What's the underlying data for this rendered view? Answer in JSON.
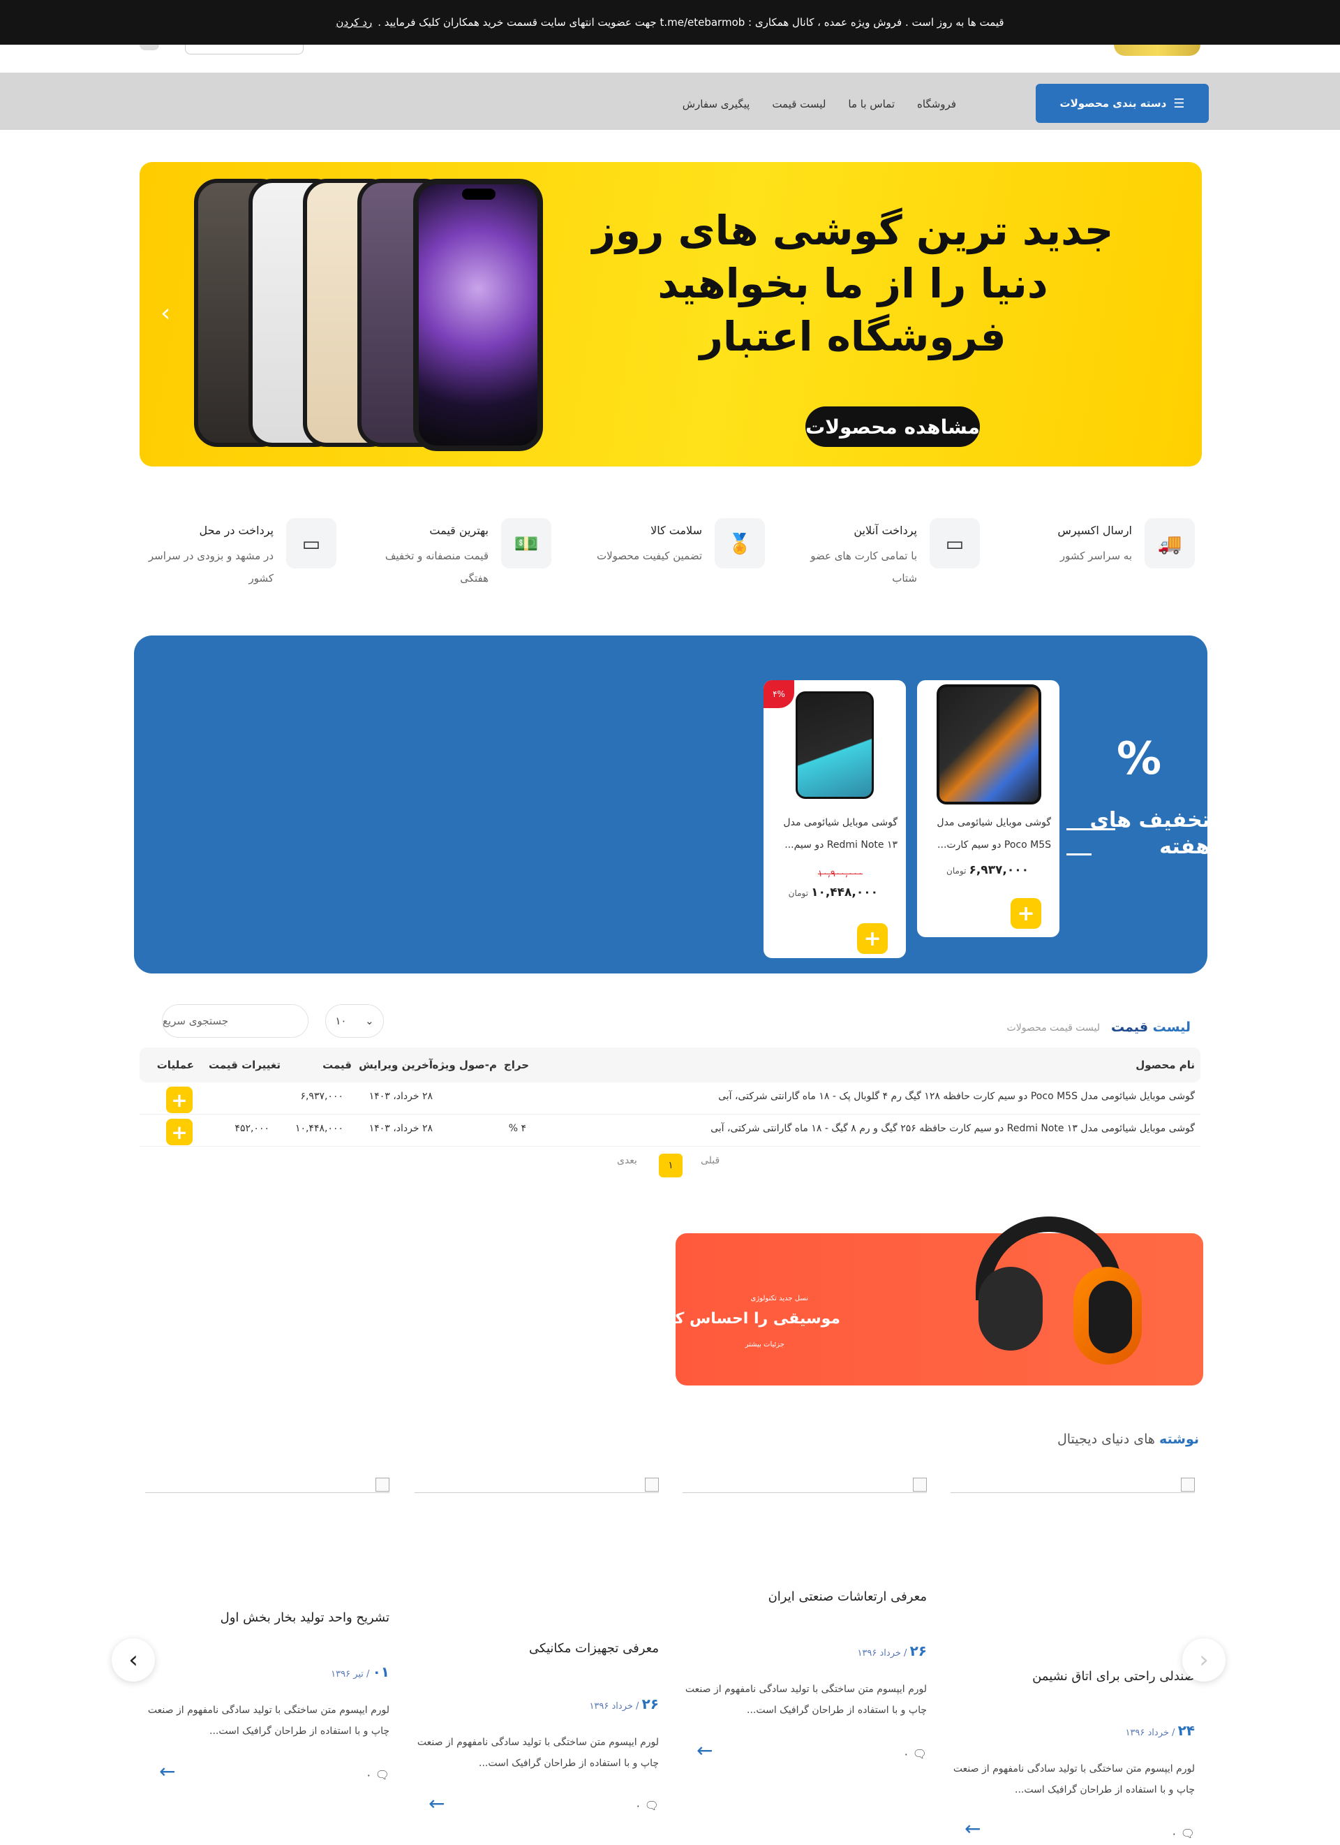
{
  "topbar": {
    "text": "قیمت ها به روز است . فروش ویژه عمده ، کانال همکاری : t.me/etebarmob جهت عضویت انتهای سایت قسمت خرید همکاران کلیک فرمایید .",
    "link": "رد کردن"
  },
  "nav": {
    "category_button": "دسته بندی محصولات",
    "items": [
      "فروشگاه",
      "تماس با ما",
      "لیست قیمت",
      "پیگیری سفارش"
    ]
  },
  "hero": {
    "title_lines": [
      "جدید ترین گوشی های روز",
      "دنیا را از ما بخواهید",
      "فروشگاه اعتبار"
    ],
    "button": "مشاهده محصولات",
    "background": "#ffd600"
  },
  "features": [
    {
      "title": "ارسال اکسپرس",
      "desc": "به سراسر کشور",
      "icon": "truck-icon"
    },
    {
      "title": "پرداخت آنلاین",
      "desc": "با تمامی کارت های عضو شتاب",
      "icon": "card-icon"
    },
    {
      "title": "سلامت کالا",
      "desc": "تضمین کیفیت محصولات",
      "icon": "medal-icon"
    },
    {
      "title": "بهترین قیمت",
      "desc": "قیمت منصفانه و تخفیف هفتگی",
      "icon": "money-icon"
    },
    {
      "title": "پرداخت در محل",
      "desc": "در مشهد و بزودی در سراسر کشور",
      "icon": "card-icon"
    }
  ],
  "discount": {
    "symbol": "%",
    "title": "تخفیف های هفته",
    "background": "#2a71b8",
    "products": [
      {
        "name": "گوشی موبایل شیائومی مدل Poco M5S دو سیم کارت...",
        "old_price": "",
        "price": "۶,۹۳۷,۰۰۰",
        "currency": "تومان",
        "badge": ""
      },
      {
        "name": "گوشی موبایل شیائومی مدل Redmi Note ۱۳ دو سیم...",
        "old_price": "۱۰,۹۰۰,۰۰۰",
        "price": "۱۰,۴۴۸,۰۰۰",
        "currency": "تومان",
        "badge": "۴%"
      }
    ]
  },
  "price_list": {
    "title_blue": "لیست",
    "title_rest": "قیمت",
    "breadcrumb": "لیست قیمت محصولات",
    "search_placeholder": "جستجوی سریع",
    "page_size": "۱۰",
    "columns": [
      "نام محصول",
      "حراج",
      "م-صول ویژه",
      "آخرین ویرایش",
      "قیمت",
      "تغییرات قیمت",
      "عملیات"
    ],
    "rows": [
      {
        "name": "گوشی موبایل شیائومی مدل Poco M5S دو سیم کارت حافظه ۱۲۸ گیگ رم ۴ گلوبال پک - ۱۸ ماه گارانتی شرکتی، آبی",
        "sale": "",
        "special": "",
        "date": "۲۸ خرداد، ۱۴۰۳",
        "price": "۶,۹۳۷,۰۰۰",
        "change": ""
      },
      {
        "name": "گوشی موبایل شیائومی مدل Redmi Note ۱۳ دو سیم کارت حافظه ۲۵۶ گیگ و رم ۸ گیگ - ۱۸ ماه گارانتی شرکتی، آبی",
        "sale": "۴ %",
        "special": "",
        "date": "۲۸ خرداد، ۱۴۰۳",
        "price": "۱۰,۴۴۸,۰۰۰",
        "change": "۴۵۲,۰۰۰"
      }
    ],
    "pager": {
      "prev": "قبلی",
      "current": "۱",
      "next": "بعدی"
    }
  },
  "music_banner": {
    "small": "نسل جدید تکنولوژی",
    "title": "موسیقی را احساس کنید",
    "more": "جزئیات بیشتر"
  },
  "blog": {
    "title_blue": "نوشته",
    "title_rest": "های دنیای دیجیتال",
    "posts": [
      {
        "title": "صندلی راحتی برای اتاق نشیمن",
        "day": "۲۴",
        "date": "/ خرداد ۱۳۹۶",
        "excerpt": "لورم ایپسوم متن ساختگی با تولید سادگی نامفهوم از صنعت چاپ و با استفاده از طراحان گرافیک است...",
        "comments": "۰"
      },
      {
        "title": "معرفی ارتعاشات صنعتی ایران",
        "day": "۲۶",
        "date": "/ خرداد ۱۳۹۶",
        "excerpt": "لورم ایپسوم متن ساختگی با تولید سادگی نامفهوم از صنعت چاپ و با استفاده از طراحان گرافیک است...",
        "comments": "۰"
      },
      {
        "title": "معرفی تجهیزات مکانیکی",
        "day": "۲۶",
        "date": "/ خرداد ۱۳۹۶",
        "excerpt": "لورم ایپسوم متن ساختگی با تولید سادگی نامفهوم از صنعت چاپ و با استفاده از طراحان گرافیک است...",
        "comments": "۰"
      },
      {
        "title": "تشریح واحد تولید بخار بخش اول",
        "day": "۰۱",
        "date": "/ تیر ۱۳۹۶",
        "excerpt": "لورم ایپسوم متن ساختگی با تولید سادگی نامفهوم از صنعت چاپ و با استفاده از طراحان گرافیک است...",
        "comments": "۰"
      }
    ]
  },
  "colors": {
    "accent": "#2a72bd",
    "yellow": "#ffcc00",
    "sale_red": "#e41e2d",
    "music_orange": "#ff5a3c"
  }
}
